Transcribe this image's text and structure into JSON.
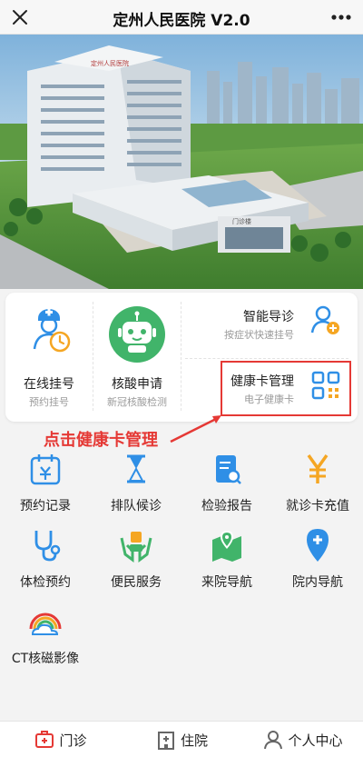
{
  "header": {
    "title": "定州人民医院 V2.0",
    "close_icon": "close-icon",
    "more_icon": "more-icon"
  },
  "banner": {
    "sign_text": "定州人民医院",
    "gate_text": "门诊楼"
  },
  "quick": {
    "online_register": {
      "label": "在线挂号",
      "sub": "预约挂号",
      "icon": "doctor-clock-icon"
    },
    "nucleic": {
      "label": "核酸申请",
      "sub": "新冠核酸检测",
      "icon": "robot-icon"
    },
    "smart_guide": {
      "label": "智能导诊",
      "sub": "按症状快速挂号",
      "icon": "person-plus-icon"
    },
    "health_card": {
      "label": "健康卡管理",
      "sub": "电子健康卡",
      "icon": "qr-card-icon"
    }
  },
  "annotation": {
    "text": "点击健康卡管理",
    "color": "#e53935"
  },
  "services": [
    {
      "label": "预约记录",
      "icon": "calendar-icon"
    },
    {
      "label": "排队候诊",
      "icon": "hourglass-icon"
    },
    {
      "label": "检验报告",
      "icon": "report-icon"
    },
    {
      "label": "就诊卡充值",
      "icon": "yuan-icon"
    },
    {
      "label": "体检预约",
      "icon": "stethoscope-icon"
    },
    {
      "label": "便民服务",
      "icon": "hands-box-icon"
    },
    {
      "label": "来院导航",
      "icon": "map-pin-icon"
    },
    {
      "label": "院内导航",
      "icon": "location-plus-icon"
    },
    {
      "label": "CT核磁影像",
      "icon": "rainbow-cloud-icon"
    }
  ],
  "tabs": [
    {
      "label": "门诊",
      "icon": "clinic-icon"
    },
    {
      "label": "住院",
      "icon": "hospital-icon"
    },
    {
      "label": "个人中心",
      "icon": "user-icon"
    }
  ],
  "colors": {
    "blue": "#2f8fe6",
    "green": "#41b46a",
    "orange": "#f5a623",
    "red": "#e53935"
  }
}
